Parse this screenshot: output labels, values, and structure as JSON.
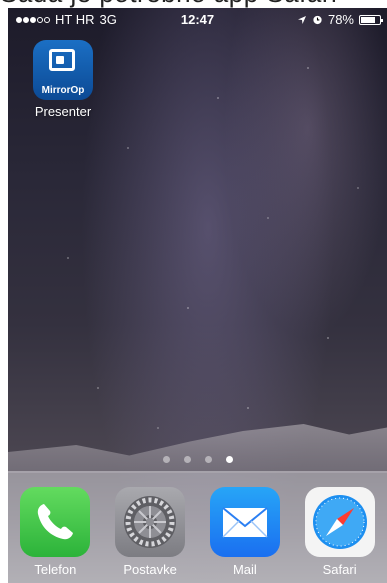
{
  "top_caption": "Sada je potrebno app Safari",
  "statusbar": {
    "carrier": "HT HR",
    "network": "3G",
    "time": "12:47",
    "battery_percent": "78%",
    "battery_level": 0.78
  },
  "apps": [
    {
      "label": "Presenter",
      "icon_text": "MirrorOp",
      "icon": "mirrorop-icon"
    }
  ],
  "page_dots": {
    "count": 4,
    "active_index": 3
  },
  "dock": [
    {
      "label": "Telefon",
      "icon": "phone-icon"
    },
    {
      "label": "Postavke",
      "icon": "settings-icon"
    },
    {
      "label": "Mail",
      "icon": "mail-icon"
    },
    {
      "label": "Safari",
      "icon": "safari-icon"
    }
  ],
  "colors": {
    "mirrorop_blue": "#1b6fc4",
    "phone_green": "#4cd964",
    "mail_blue": "#1a6ff0"
  }
}
